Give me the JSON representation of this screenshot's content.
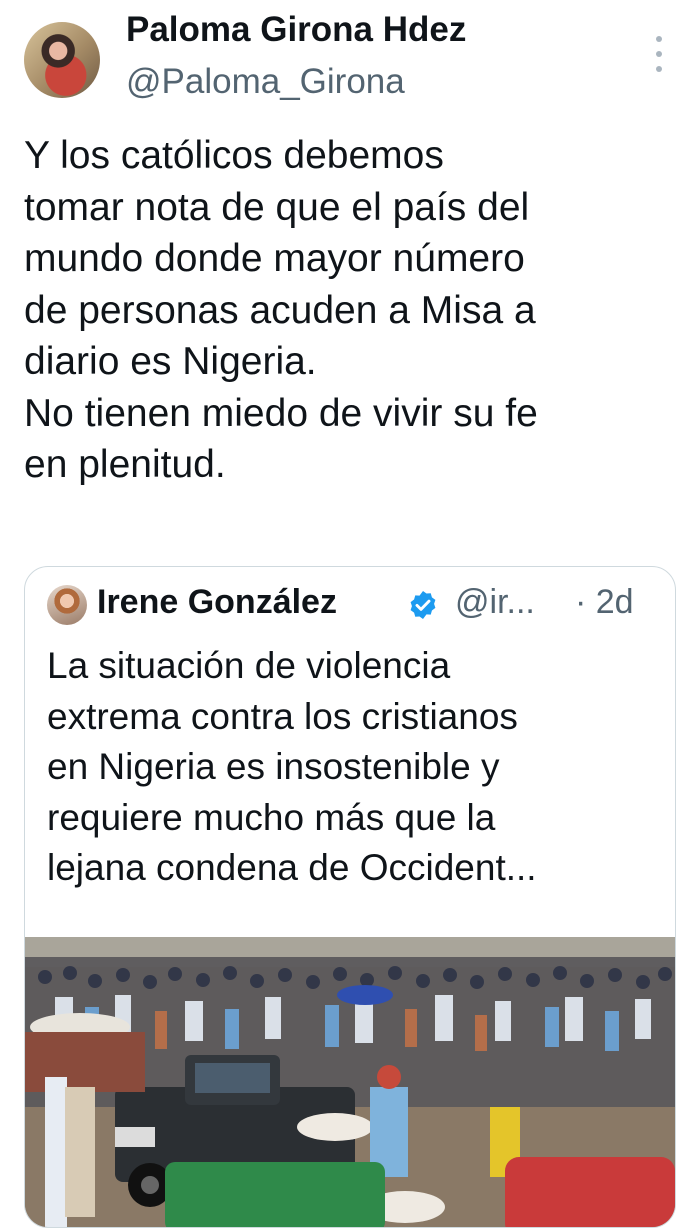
{
  "author": {
    "name": "Paloma Girona Hdez",
    "handle": "@Paloma_Girona"
  },
  "tweet": {
    "text": "Y los católicos debemos\ntomar nota de que el país del\nmundo donde mayor número\nde personas acuden a Misa a\ndiario es Nigeria.\nNo tienen miedo de vivir su fe\nen plenitud."
  },
  "quoted": {
    "name": "Irene González",
    "handle": "@ir...",
    "time": "· 2d",
    "text": "La situación de violencia\nextrema contra los cristianos\nen Nigeria es insostenible y\nrequiere mucho más que la\nlejana condena de Occident...",
    "verified_color": "#1d9bf0"
  },
  "icons": {
    "more": "more-vertical-icon",
    "verified": "verified-badge-icon"
  }
}
